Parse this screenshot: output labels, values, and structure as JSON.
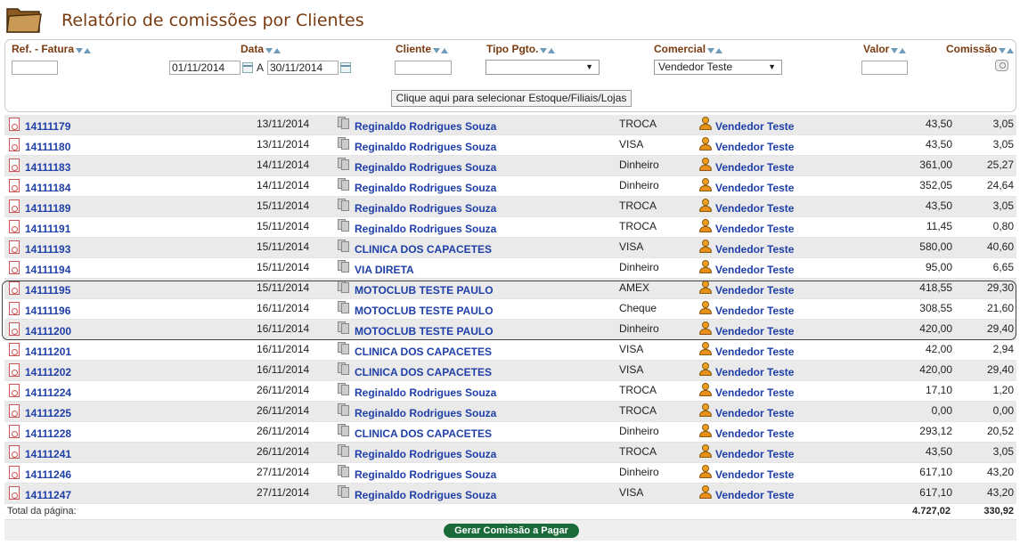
{
  "page": {
    "title": "Relatório de comissões por Clientes"
  },
  "columns": {
    "ref": "Ref. - Fatura",
    "date": "Data",
    "client": "Cliente",
    "payment_type": "Tipo Pgto.",
    "commercial": "Comercial",
    "value": "Valor",
    "commission": "Comissão"
  },
  "filters": {
    "ref": "",
    "date_from": "01/11/2014",
    "date_to_label": "A",
    "date_to": "30/11/2014",
    "client": "",
    "payment_type": "",
    "commercial": "Vendedor Teste",
    "value": "",
    "store_button": "Clique aqui para selecionar Estoque/Filiais/Lojas"
  },
  "rows": [
    {
      "ref": "14111179",
      "date": "13/11/2014",
      "client": "Reginaldo Rodrigues Souza",
      "payment": "TROCA",
      "rep": "Vendedor Teste",
      "value": "43,50",
      "commission": "3,05"
    },
    {
      "ref": "14111180",
      "date": "13/11/2014",
      "client": "Reginaldo Rodrigues Souza",
      "payment": "VISA",
      "rep": "Vendedor Teste",
      "value": "43,50",
      "commission": "3,05"
    },
    {
      "ref": "14111183",
      "date": "14/11/2014",
      "client": "Reginaldo Rodrigues Souza",
      "payment": "Dinheiro",
      "rep": "Vendedor Teste",
      "value": "361,00",
      "commission": "25,27"
    },
    {
      "ref": "14111184",
      "date": "14/11/2014",
      "client": "Reginaldo Rodrigues Souza",
      "payment": "Dinheiro",
      "rep": "Vendedor Teste",
      "value": "352,05",
      "commission": "24,64"
    },
    {
      "ref": "14111189",
      "date": "15/11/2014",
      "client": "Reginaldo Rodrigues Souza",
      "payment": "TROCA",
      "rep": "Vendedor Teste",
      "value": "43,50",
      "commission": "3,05"
    },
    {
      "ref": "14111191",
      "date": "15/11/2014",
      "client": "Reginaldo Rodrigues Souza",
      "payment": "TROCA",
      "rep": "Vendedor Teste",
      "value": "11,45",
      "commission": "0,80"
    },
    {
      "ref": "14111193",
      "date": "15/11/2014",
      "client": "CLINICA DOS CAPACETES",
      "payment": "VISA",
      "rep": "Vendedor Teste",
      "value": "580,00",
      "commission": "40,60"
    },
    {
      "ref": "14111194",
      "date": "15/11/2014",
      "client": "VIA DIRETA",
      "payment": "Dinheiro",
      "rep": "Vendedor Teste",
      "value": "95,00",
      "commission": "6,65"
    },
    {
      "ref": "14111195",
      "date": "15/11/2014",
      "client": "MOTOCLUB TESTE PAULO",
      "payment": "AMEX",
      "rep": "Vendedor Teste",
      "value": "418,55",
      "commission": "29,30"
    },
    {
      "ref": "14111196",
      "date": "16/11/2014",
      "client": "MOTOCLUB TESTE PAULO",
      "payment": "Cheque",
      "rep": "Vendedor Teste",
      "value": "308,55",
      "commission": "21,60"
    },
    {
      "ref": "14111200",
      "date": "16/11/2014",
      "client": "MOTOCLUB TESTE PAULO",
      "payment": "Dinheiro",
      "rep": "Vendedor Teste",
      "value": "420,00",
      "commission": "29,40"
    },
    {
      "ref": "14111201",
      "date": "16/11/2014",
      "client": "CLINICA DOS CAPACETES",
      "payment": "VISA",
      "rep": "Vendedor Teste",
      "value": "42,00",
      "commission": "2,94"
    },
    {
      "ref": "14111202",
      "date": "16/11/2014",
      "client": "CLINICA DOS CAPACETES",
      "payment": "VISA",
      "rep": "Vendedor Teste",
      "value": "420,00",
      "commission": "29,40"
    },
    {
      "ref": "14111224",
      "date": "26/11/2014",
      "client": "Reginaldo Rodrigues Souza",
      "payment": "TROCA",
      "rep": "Vendedor Teste",
      "value": "17,10",
      "commission": "1,20"
    },
    {
      "ref": "14111225",
      "date": "26/11/2014",
      "client": "Reginaldo Rodrigues Souza",
      "payment": "TROCA",
      "rep": "Vendedor Teste",
      "value": "0,00",
      "commission": "0,00"
    },
    {
      "ref": "14111228",
      "date": "26/11/2014",
      "client": "CLINICA DOS CAPACETES",
      "payment": "Dinheiro",
      "rep": "Vendedor Teste",
      "value": "293,12",
      "commission": "20,52"
    },
    {
      "ref": "14111241",
      "date": "26/11/2014",
      "client": "Reginaldo Rodrigues Souza",
      "payment": "TROCA",
      "rep": "Vendedor Teste",
      "value": "43,50",
      "commission": "3,05"
    },
    {
      "ref": "14111246",
      "date": "27/11/2014",
      "client": "Reginaldo Rodrigues Souza",
      "payment": "Dinheiro",
      "rep": "Vendedor Teste",
      "value": "617,10",
      "commission": "43,20"
    },
    {
      "ref": "14111247",
      "date": "27/11/2014",
      "client": "Reginaldo Rodrigues Souza",
      "payment": "VISA",
      "rep": "Vendedor Teste",
      "value": "617,10",
      "commission": "43,20"
    }
  ],
  "totals": {
    "label": "Total da página:",
    "value": "4.727,02",
    "commission": "330,92"
  },
  "actions": {
    "generate": "Gerar Comissão a Pagar"
  }
}
